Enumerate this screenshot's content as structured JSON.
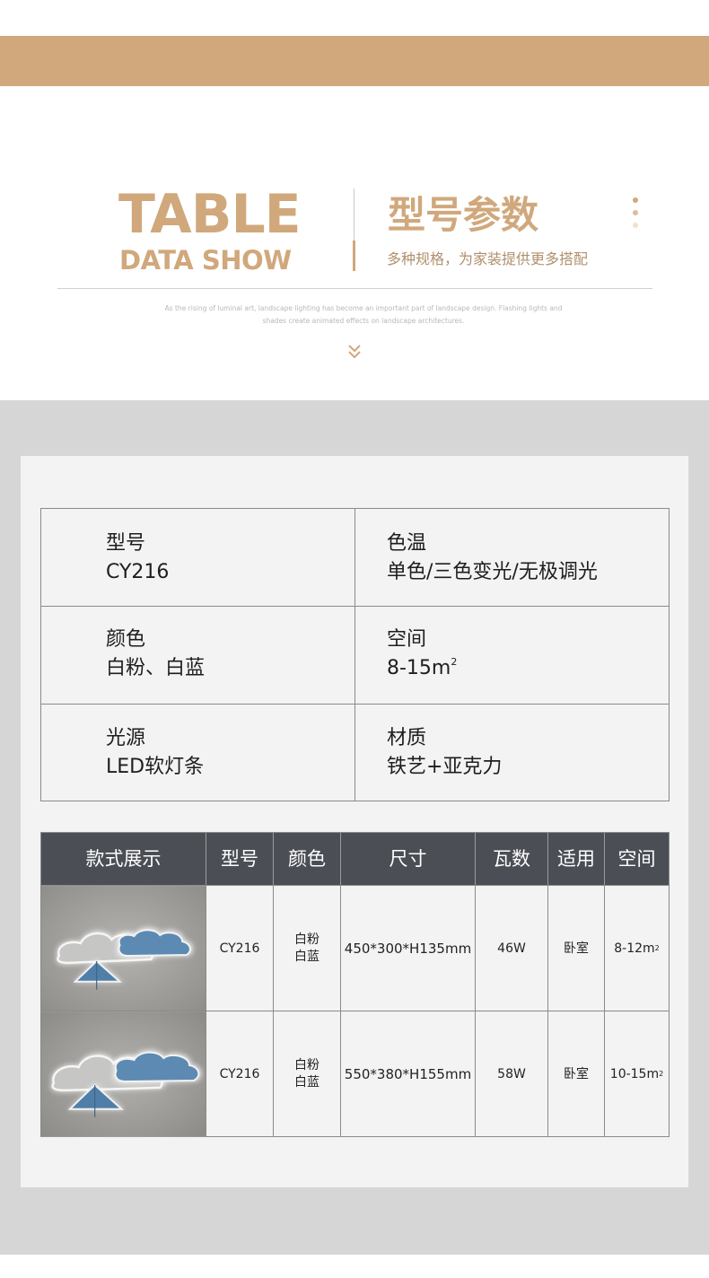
{
  "header": {
    "title_en_line1": "TABLE",
    "title_en_line2": "DATA SHOW",
    "title_cn": "型号参数",
    "subtitle_cn": "多种规格，为家装提供更多搭配",
    "description": "As the rising of luminal art, landscape lighting has become an important part of landscape design. Flashing lights and shades create animated effects on landscape architectures.",
    "chevron_icon": "double-chevron-down-icon",
    "brand_color": "#d0a87c"
  },
  "specs": [
    {
      "label": "型号",
      "value": "CY216"
    },
    {
      "label": "色温",
      "value": "单色/三色变光/无极调光"
    },
    {
      "label": "颜色",
      "value": "白粉、白蓝"
    },
    {
      "label": "空间",
      "value": "8-15m",
      "value_sup": "2"
    },
    {
      "label": "光源",
      "value": "LED软灯条"
    },
    {
      "label": "材质",
      "value": "铁艺+亚克力"
    }
  ],
  "product_table": {
    "header_color": "#4b4f55",
    "columns": [
      "款式展示",
      "型号",
      "颜色",
      "尺寸",
      "瓦数",
      "适用",
      "空间"
    ],
    "rows": [
      {
        "image": "cloud-kite-ceiling-lamp-small",
        "model": "CY216",
        "color_line1": "白粉",
        "color_line2": "白蓝",
        "size": "450*300*H135mm",
        "watt": "46W",
        "room": "卧室",
        "space": "8-12m",
        "space_sup": "2"
      },
      {
        "image": "cloud-kite-ceiling-lamp-large",
        "model": "CY216",
        "color_line1": "白粉",
        "color_line2": "白蓝",
        "size": "550*380*H155mm",
        "watt": "58W",
        "room": "卧室",
        "space": "10-15m",
        "space_sup": "2"
      }
    ]
  }
}
